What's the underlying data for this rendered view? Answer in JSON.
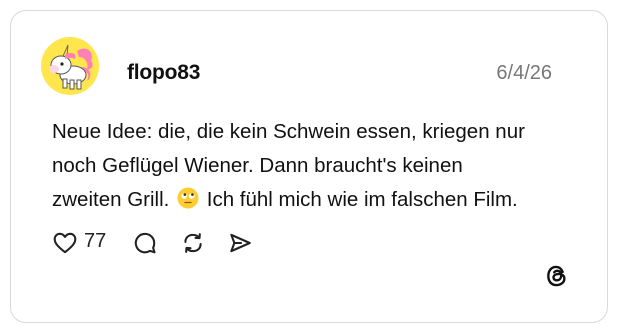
{
  "post": {
    "username": "flopo83",
    "date": "6/4/26",
    "line1": "Neue Idee: die, die kein Schwein essen, kriegen nur",
    "line2": "noch Geflügel Wiener. Dann braucht's keinen",
    "line3_before_emoji": "zweiten Grill.",
    "line3_after_emoji": "Ich fühl mich wie im falschen Film.",
    "emoji": "face-with-rolling-eyes"
  },
  "actions": {
    "like_count": "77",
    "icons": [
      "heart-icon",
      "comment-icon",
      "repost-icon",
      "share-icon"
    ]
  },
  "branding": {
    "logo": "threads-logo"
  },
  "colors": {
    "avatar_bg": "#ffe64d",
    "muted_text": "#777777",
    "border": "#d9d9d9"
  }
}
